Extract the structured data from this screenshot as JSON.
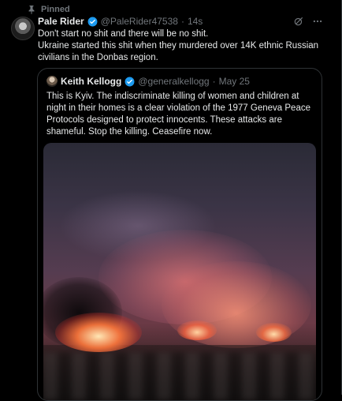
{
  "pinned_label": "Pinned",
  "tweet": {
    "display_name": "Pale Rider",
    "handle": "@PaleRider47538",
    "separator": "·",
    "time": "14s",
    "text_lines": [
      "Don't start no shit and there will be no shit.",
      "Ukraine started this shit when they murdered over 14K ethnic Russian civilians in the Donbas region."
    ]
  },
  "quote": {
    "display_name": "Keith Kellogg",
    "handle": "@generalkellogg",
    "separator": "·",
    "time": "May 25",
    "text": "This is Kyiv. The indiscriminate killing of women and children at night in their homes is a clear violation of the 1977 Geneva Peace Protocols designed to protect innocents. These attacks are shameful. Stop the killing. Ceasefire now."
  },
  "colors": {
    "background": "#000000",
    "text": "#e7e9ea",
    "muted": "#71767b",
    "verified": "#1d9bf0",
    "border": "#2f3336"
  },
  "icons": [
    "pin-icon",
    "verified-icon",
    "grok-icon",
    "more-icon"
  ]
}
